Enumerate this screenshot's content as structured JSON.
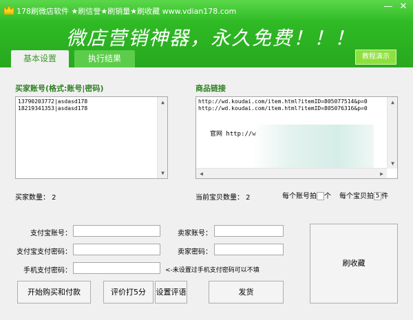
{
  "window": {
    "title": "178刷微店软件 ★刷信誉★刷销量★刷收藏 www.vdian178.com",
    "minimize_label": "—",
    "close_label": "✕"
  },
  "banner": {
    "slogan": "微店营销神器，永久免费！！！",
    "tabs": [
      {
        "label": "基本设置",
        "active": true
      },
      {
        "label": "执行结果",
        "active": false
      }
    ],
    "demo_button": "教程演示"
  },
  "buyer": {
    "label": "买家账号(格式:账号|密码)",
    "lines": [
      "13790203772|asdasd178",
      "18219341353|asdasd178"
    ],
    "count_text": "买家数量：  2"
  },
  "product": {
    "label": "商品链接",
    "lines": [
      "http://wd.koudai.com/item.html?itemID=805077514&p=0",
      "http://wd.koudai.com/item.html?itemID=805076316&p=0"
    ],
    "official_text": "官网 http://w",
    "count_text": "当前宝贝数量：  2",
    "per_account_prefix": "每个账号拍",
    "per_account_value": "",
    "per_account_suffix": "个",
    "per_item_prefix": "每个宝贝拍",
    "per_item_value": "5",
    "per_item_suffix": "件"
  },
  "form": {
    "alipay_account_label": "支付宝账号：",
    "alipay_account_value": "",
    "alipay_pay_password_label": "支付宝支付密码：",
    "alipay_pay_password_value": "",
    "mobile_pay_password_label": "手机支付密码：",
    "mobile_pay_password_value": "",
    "mobile_pay_hint": "<-未设置过手机支付密码可以不填",
    "seller_account_label": "卖家账号：",
    "seller_account_value": "",
    "seller_password_label": "卖家密码：",
    "seller_password_value": ""
  },
  "buttons": {
    "start": "开始购买和付款",
    "rate5": "评价打5分",
    "set_review": "设置评语",
    "ship": "发货",
    "favorite": "刷收藏"
  },
  "colors": {
    "accent_green": "#2fba25",
    "label_green": "#2e7f22",
    "demo_button": "#8ee03f"
  },
  "icons": {
    "app": "crown-icon",
    "scroll_up": "arrow-up-icon",
    "scroll_down": "arrow-down-icon",
    "scroll_left": "arrow-left-icon",
    "scroll_right": "arrow-right-icon"
  }
}
